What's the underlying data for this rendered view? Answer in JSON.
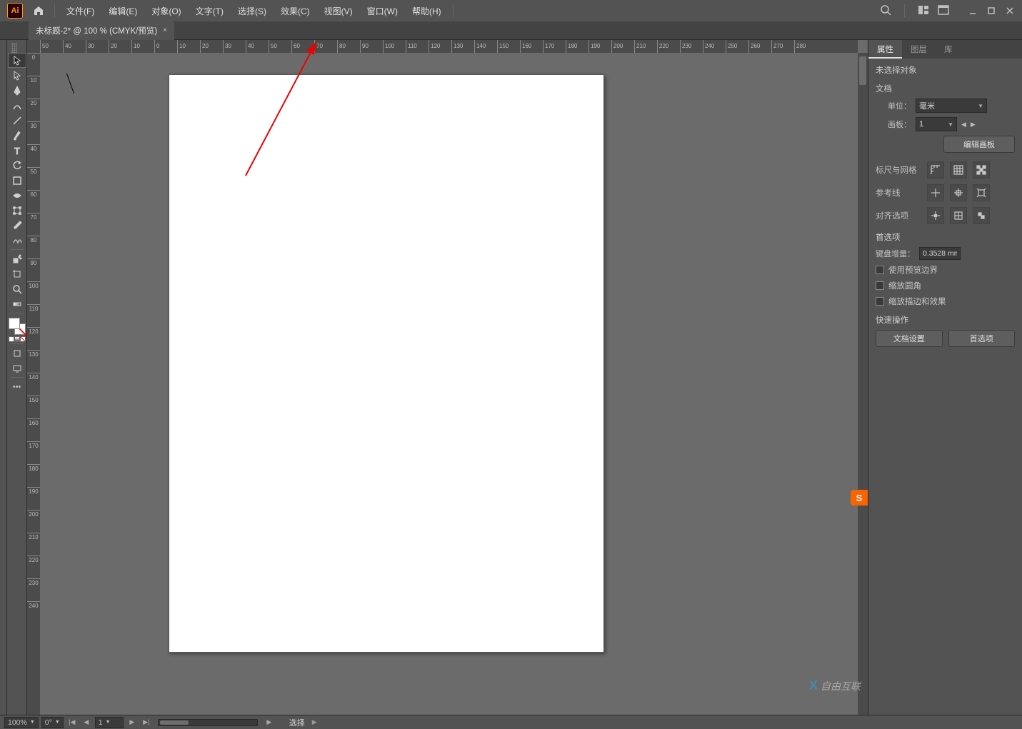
{
  "menubar": {
    "items": [
      "文件(F)",
      "编辑(E)",
      "对象(O)",
      "文字(T)",
      "选择(S)",
      "效果(C)",
      "视图(V)",
      "窗口(W)",
      "帮助(H)"
    ]
  },
  "tab": {
    "title": "未标题-2* @ 100 % (CMYK/预览)"
  },
  "ruler_h": [
    "50",
    "40",
    "30",
    "20",
    "10",
    "0",
    "10",
    "20",
    "30",
    "40",
    "50",
    "60",
    "70",
    "80",
    "90",
    "100",
    "110",
    "120",
    "130",
    "140",
    "150",
    "160",
    "170",
    "180",
    "190",
    "200",
    "210",
    "220",
    "230",
    "240",
    "250",
    "260",
    "270",
    "280"
  ],
  "ruler_v": [
    "0",
    "10",
    "20",
    "30",
    "40",
    "50",
    "60",
    "70",
    "80",
    "90",
    "100",
    "110",
    "120",
    "130",
    "140",
    "150",
    "160",
    "170",
    "180",
    "190",
    "200",
    "210",
    "220",
    "230",
    "240"
  ],
  "panel": {
    "tabs": [
      "属性",
      "图层",
      "库"
    ],
    "no_selection": "未选择对象",
    "doc_title": "文档",
    "unit_label": "单位：",
    "unit_value": "毫米",
    "artboard_label": "画板：",
    "artboard_value": "1",
    "edit_artboard_btn": "编辑画板",
    "ruler_grid_label": "标尺与网格",
    "guides_label": "参考线",
    "align_label": "对齐选项",
    "prefs_title": "首选项",
    "key_inc_label": "键盘增量：",
    "key_inc_value": "0.3528 mm",
    "chk1": "使用预览边界",
    "chk2": "缩放圆角",
    "chk3": "缩放描边和效果",
    "quick_title": "快速操作",
    "doc_setup_btn": "文档设置",
    "prefs_btn": "首选项"
  },
  "status": {
    "zoom": "100%",
    "angle": "0°",
    "page": "1",
    "tool": "选择"
  },
  "watermark": "自由互联",
  "ime": "S"
}
